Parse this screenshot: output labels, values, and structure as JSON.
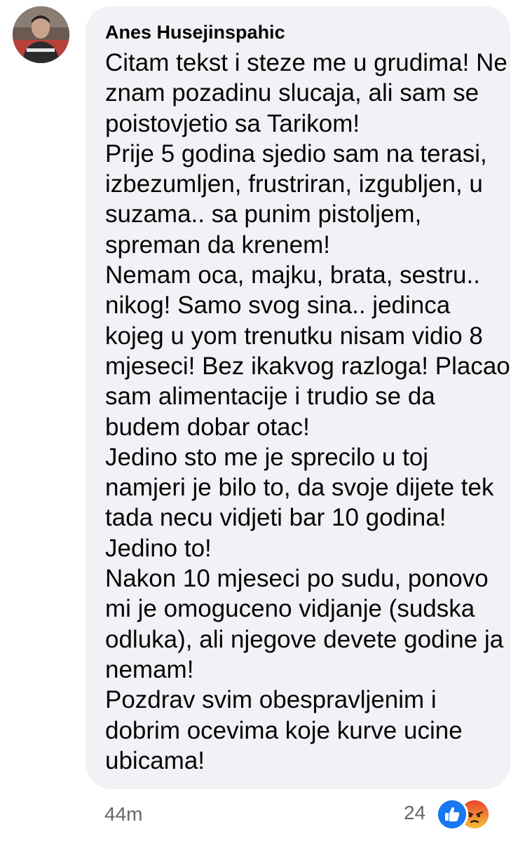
{
  "comment": {
    "author": "Anes Husejinspahic",
    "lines": [
      "Citam tekst i steze me u grudima! Ne",
      "znam pozadinu slucaja, ali sam se",
      "poistovjetio sa Tarikom!",
      "Prije 5 godina sjedio sam na terasi,",
      "izbezumljen, frustriran, izgubljen, u",
      "suzama.. sa punim pistoljem,",
      "spreman da krenem!",
      "Nemam oca, majku, brata, sestru..",
      "nikog! Samo svog sina.. jedinca",
      "kojeg u yom trenutku nisam vidio 8",
      "mjeseci! Bez ikakvog razloga! Placao",
      "sam alimentacije i trudio se da",
      "budem dobar otac!",
      "Jedino sto me je sprecilo u toj",
      "namjeri je bilo to, da svoje dijete tek",
      "tada necu vidjeti bar 10 godina!",
      "Jedino to!",
      "Nakon 10 mjeseci po sudu, ponovo",
      "mi je omoguceno vidjanje (sudska",
      "odluka), ali njegove devete godine ja",
      "nemam!",
      "Pozdrav svim obespravljenim i",
      "dobrim ocevima koje kurve ucine",
      "ubicama!"
    ],
    "time": "44m",
    "reaction_count": "24",
    "reactions": [
      "like-reaction-icon",
      "angry-reaction-icon"
    ]
  },
  "colors": {
    "bubble_bg": "#f0f2f5",
    "text": "#050505",
    "meta_text": "#65676b",
    "like_blue": "#1877f2",
    "angry_orange": "#f15840"
  }
}
